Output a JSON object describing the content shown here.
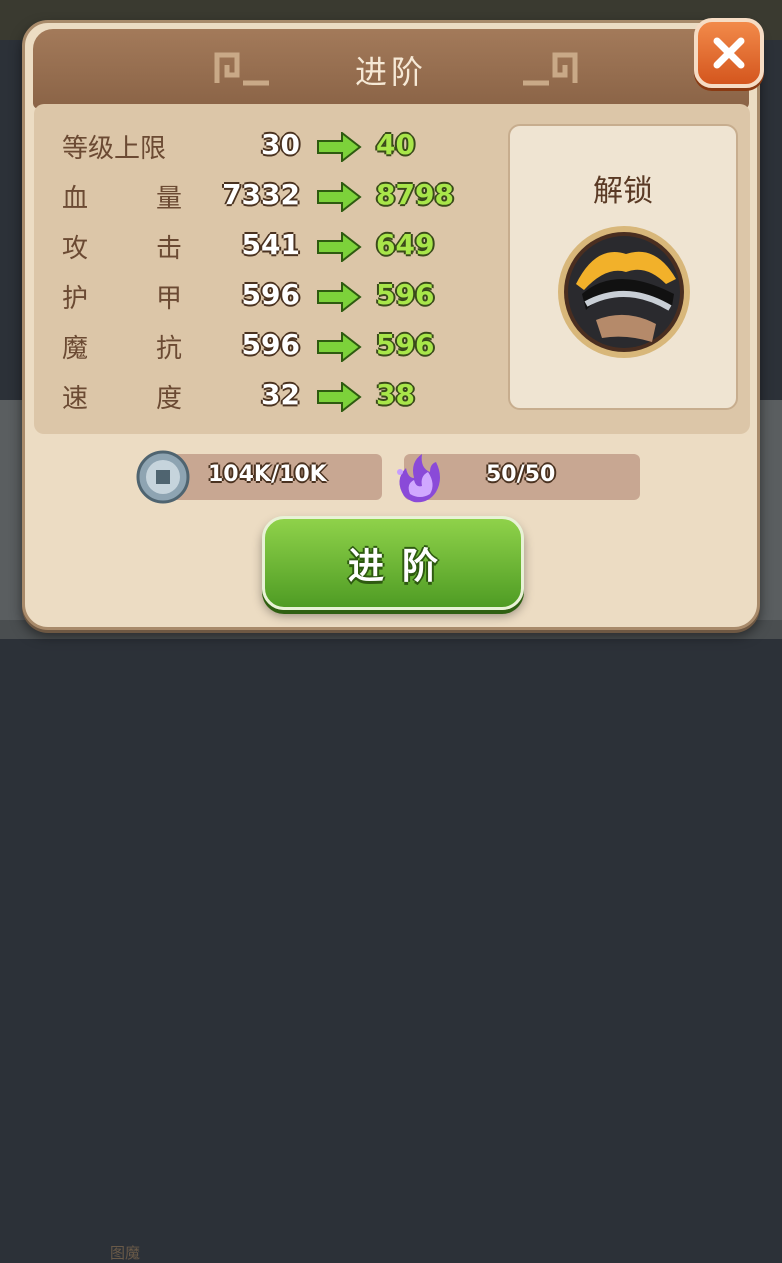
{
  "background": {
    "bottom_text": "图魔"
  },
  "dialog": {
    "title": "进阶",
    "close_icon": "close-x-icon"
  },
  "stats": [
    {
      "label_chars": [
        "等级上限"
      ],
      "old": "30",
      "new": "40"
    },
    {
      "label_chars": [
        "血",
        "量"
      ],
      "old": "7332",
      "new": "8798"
    },
    {
      "label_chars": [
        "攻",
        "击"
      ],
      "old": "541",
      "new": "649"
    },
    {
      "label_chars": [
        "护",
        "甲"
      ],
      "old": "596",
      "new": "596"
    },
    {
      "label_chars": [
        "魔",
        "抗"
      ],
      "old": "596",
      "new": "596"
    },
    {
      "label_chars": [
        "速",
        "度"
      ],
      "old": "32",
      "new": "38"
    }
  ],
  "unlock": {
    "title": "解锁",
    "skill_icon": "blade-skill-icon"
  },
  "resources": {
    "coins": {
      "icon": "coin-icon",
      "value": "104K/10K"
    },
    "essence": {
      "icon": "purple-flame-icon",
      "value": "50/50"
    }
  },
  "advance_button": {
    "label": "进阶"
  },
  "colors": {
    "panel": "#ecdcc3",
    "title_bar": "#8a6346",
    "new_value": "#a8e64a",
    "button_green": "#4f9c24",
    "close_orange": "#d4561e"
  }
}
